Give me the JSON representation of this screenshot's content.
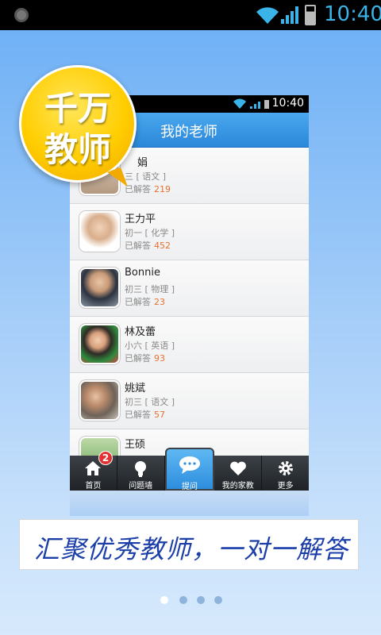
{
  "status_bar": {
    "time": "10:40"
  },
  "phone": {
    "status_time": "10:40",
    "header_title": "我的老师",
    "teachers": [
      {
        "name": "娟",
        "grade": "三 [ 语文 ]",
        "answered_label": "已解答",
        "answered": "219"
      },
      {
        "name": "王力平",
        "grade": "初一 [ 化学 ]",
        "answered_label": "已解答",
        "answered": "452"
      },
      {
        "name": "Bonnie",
        "grade": "初三 [ 物理 ]",
        "answered_label": "已解答",
        "answered": "23"
      },
      {
        "name": "林及蕾",
        "grade": "小六 [ 英语 ]",
        "answered_label": "已解答",
        "answered": "93"
      },
      {
        "name": "姚斌",
        "grade": "初三 [ 语文 ]",
        "answered_label": "已解答",
        "answered": "57"
      },
      {
        "name": "王硕",
        "grade": "",
        "answered_label": "",
        "answered": ""
      }
    ],
    "tabs": [
      {
        "label": "首页",
        "badge": "2"
      },
      {
        "label": "问题墙"
      },
      {
        "label": "提问"
      },
      {
        "label": "我的家教"
      },
      {
        "label": "更多"
      }
    ]
  },
  "bubble": {
    "line1": "千万",
    "line2": "教师"
  },
  "banner": {
    "text": "汇聚优秀教师，一对一解答"
  },
  "pager": {
    "count": 4,
    "active_index": 0
  }
}
